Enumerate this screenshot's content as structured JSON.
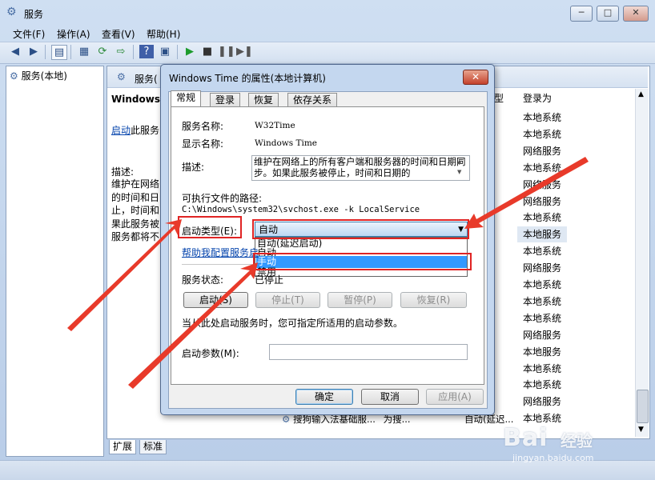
{
  "window": {
    "title": "服务",
    "minimize": "─",
    "maximize": "□",
    "close": "✕"
  },
  "menu": [
    "文件(F)",
    "操作(A)",
    "查看(V)",
    "帮助(H)"
  ],
  "tree": {
    "item": "服务(本地)"
  },
  "pane": {
    "header": "服务(",
    "service_name": "Windows",
    "start_link": "启动",
    "start_suffix": "此服务",
    "desc_label": "描述:",
    "desc_lines": [
      "维护在网络",
      "的时间和日",
      "止，时间和",
      "果此服务被",
      "服务都将不"
    ],
    "col_type": "型",
    "col_logon": "登录为",
    "rows": [
      "本地系统",
      "本地系统",
      "网络服务",
      "本地系统",
      "网络服务",
      "网络服务",
      "本地系统",
      "本地服务",
      "本地系统",
      "网络服务",
      "本地系统",
      "本地系统",
      "本地系统",
      "网络服务",
      "本地服务",
      "本地系统",
      "本地系统",
      "网络服务",
      "本地系统"
    ],
    "partial_row": {
      "name": "搜狗输入法基础服...",
      "desc": "为搜...",
      "startup": "自动(延迟..."
    }
  },
  "bottom_tabs": [
    "扩展",
    "标准"
  ],
  "dialog": {
    "title": "Windows Time 的属性(本地计算机)",
    "close": "✕",
    "tabs": [
      "常规",
      "登录",
      "恢复",
      "依存关系"
    ],
    "service_name_label": "服务名称:",
    "service_name_value": "W32Time",
    "display_name_label": "显示名称:",
    "display_name_value": "Windows Time",
    "description_label": "描述:",
    "description_text": "维护在网络上的所有客户端和服务器的时间和日期同步。如果此服务被停止，时间和日期的",
    "path_label": "可执行文件的路径:",
    "path_value": "C:\\Windows\\system32\\svchost.exe -k LocalService",
    "startup_type_label": "启动类型(E):",
    "startup_selected": "自动",
    "startup_options": [
      "自动(延迟启动)",
      "自动",
      "手动",
      "禁用"
    ],
    "help_link": "帮助我配置服务启",
    "status_label": "服务状态:",
    "status_value": "已停止",
    "btn_start": "启动(S)",
    "btn_stop": "停止(T)",
    "btn_pause": "暂停(P)",
    "btn_resume": "恢复(R)",
    "hint": "当从此处启动服务时，您可指定所适用的启动参数。",
    "params_label": "启动参数(M):",
    "params_value": "",
    "ok": "确定",
    "cancel": "取消",
    "apply": "应用(A)"
  },
  "watermark": {
    "logo": "Bai",
    "brand": "经验",
    "url": "jingyan.baidu.com"
  },
  "colors": {
    "annotation_red": "#e02424",
    "selection_blue": "#3399ff",
    "link_blue": "#0645ad"
  }
}
